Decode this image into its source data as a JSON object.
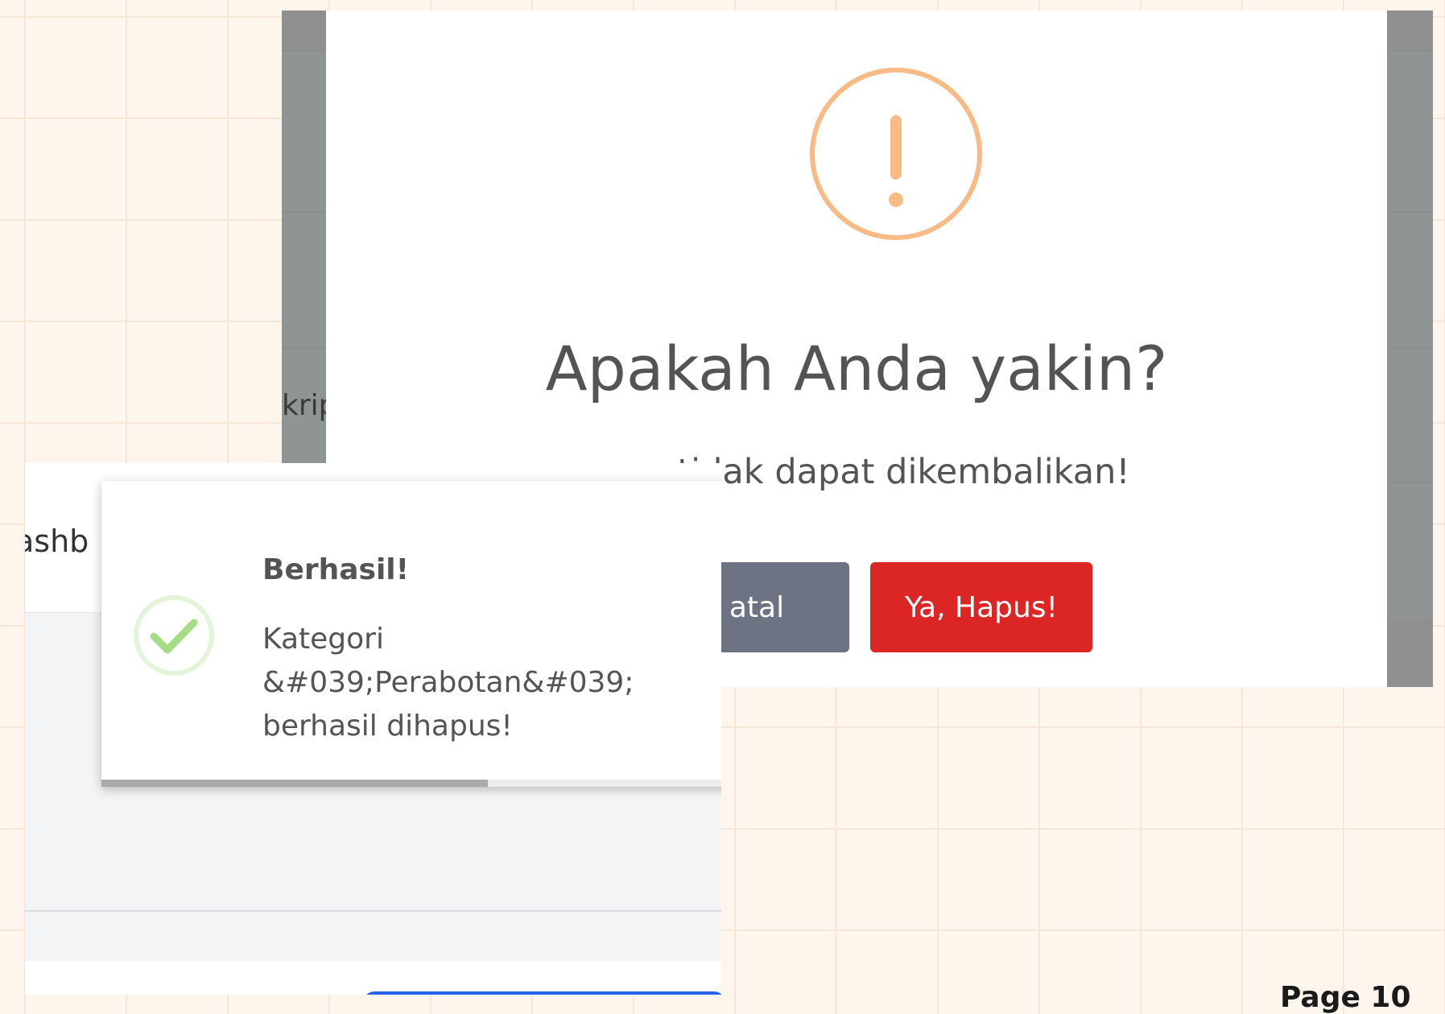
{
  "confirm_dialog": {
    "background_partial_text": "krip",
    "title": "Apakah Anda yakin?",
    "text": "apus tidak dapat dikembalikan!",
    "cancel_label": "atal",
    "confirm_label": "Ya, Hapus!",
    "icon": "warning-exclamation-icon",
    "accent_color": "#f8bb86",
    "confirm_color": "#dc2626",
    "cancel_color": "#6e7384"
  },
  "success_toast": {
    "navbar_partial_text": "ashb",
    "title": "Berhasil!",
    "message": "Kategori &#039;Perabotan&#039; berhasil dihapus!",
    "icon": "success-check-icon",
    "success_color": "#a5dc86",
    "timer_progress": 0.6
  },
  "page_label": "Page 10"
}
